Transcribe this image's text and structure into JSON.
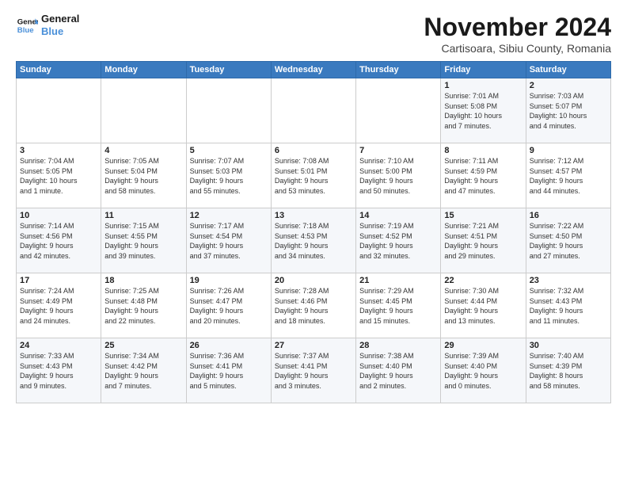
{
  "header": {
    "logo_line1": "General",
    "logo_line2": "Blue",
    "title": "November 2024",
    "subtitle": "Cartisoara, Sibiu County, Romania"
  },
  "weekdays": [
    "Sunday",
    "Monday",
    "Tuesday",
    "Wednesday",
    "Thursday",
    "Friday",
    "Saturday"
  ],
  "weeks": [
    [
      {
        "day": "",
        "info": ""
      },
      {
        "day": "",
        "info": ""
      },
      {
        "day": "",
        "info": ""
      },
      {
        "day": "",
        "info": ""
      },
      {
        "day": "",
        "info": ""
      },
      {
        "day": "1",
        "info": "Sunrise: 7:01 AM\nSunset: 5:08 PM\nDaylight: 10 hours\nand 7 minutes."
      },
      {
        "day": "2",
        "info": "Sunrise: 7:03 AM\nSunset: 5:07 PM\nDaylight: 10 hours\nand 4 minutes."
      }
    ],
    [
      {
        "day": "3",
        "info": "Sunrise: 7:04 AM\nSunset: 5:05 PM\nDaylight: 10 hours\nand 1 minute."
      },
      {
        "day": "4",
        "info": "Sunrise: 7:05 AM\nSunset: 5:04 PM\nDaylight: 9 hours\nand 58 minutes."
      },
      {
        "day": "5",
        "info": "Sunrise: 7:07 AM\nSunset: 5:03 PM\nDaylight: 9 hours\nand 55 minutes."
      },
      {
        "day": "6",
        "info": "Sunrise: 7:08 AM\nSunset: 5:01 PM\nDaylight: 9 hours\nand 53 minutes."
      },
      {
        "day": "7",
        "info": "Sunrise: 7:10 AM\nSunset: 5:00 PM\nDaylight: 9 hours\nand 50 minutes."
      },
      {
        "day": "8",
        "info": "Sunrise: 7:11 AM\nSunset: 4:59 PM\nDaylight: 9 hours\nand 47 minutes."
      },
      {
        "day": "9",
        "info": "Sunrise: 7:12 AM\nSunset: 4:57 PM\nDaylight: 9 hours\nand 44 minutes."
      }
    ],
    [
      {
        "day": "10",
        "info": "Sunrise: 7:14 AM\nSunset: 4:56 PM\nDaylight: 9 hours\nand 42 minutes."
      },
      {
        "day": "11",
        "info": "Sunrise: 7:15 AM\nSunset: 4:55 PM\nDaylight: 9 hours\nand 39 minutes."
      },
      {
        "day": "12",
        "info": "Sunrise: 7:17 AM\nSunset: 4:54 PM\nDaylight: 9 hours\nand 37 minutes."
      },
      {
        "day": "13",
        "info": "Sunrise: 7:18 AM\nSunset: 4:53 PM\nDaylight: 9 hours\nand 34 minutes."
      },
      {
        "day": "14",
        "info": "Sunrise: 7:19 AM\nSunset: 4:52 PM\nDaylight: 9 hours\nand 32 minutes."
      },
      {
        "day": "15",
        "info": "Sunrise: 7:21 AM\nSunset: 4:51 PM\nDaylight: 9 hours\nand 29 minutes."
      },
      {
        "day": "16",
        "info": "Sunrise: 7:22 AM\nSunset: 4:50 PM\nDaylight: 9 hours\nand 27 minutes."
      }
    ],
    [
      {
        "day": "17",
        "info": "Sunrise: 7:24 AM\nSunset: 4:49 PM\nDaylight: 9 hours\nand 24 minutes."
      },
      {
        "day": "18",
        "info": "Sunrise: 7:25 AM\nSunset: 4:48 PM\nDaylight: 9 hours\nand 22 minutes."
      },
      {
        "day": "19",
        "info": "Sunrise: 7:26 AM\nSunset: 4:47 PM\nDaylight: 9 hours\nand 20 minutes."
      },
      {
        "day": "20",
        "info": "Sunrise: 7:28 AM\nSunset: 4:46 PM\nDaylight: 9 hours\nand 18 minutes."
      },
      {
        "day": "21",
        "info": "Sunrise: 7:29 AM\nSunset: 4:45 PM\nDaylight: 9 hours\nand 15 minutes."
      },
      {
        "day": "22",
        "info": "Sunrise: 7:30 AM\nSunset: 4:44 PM\nDaylight: 9 hours\nand 13 minutes."
      },
      {
        "day": "23",
        "info": "Sunrise: 7:32 AM\nSunset: 4:43 PM\nDaylight: 9 hours\nand 11 minutes."
      }
    ],
    [
      {
        "day": "24",
        "info": "Sunrise: 7:33 AM\nSunset: 4:43 PM\nDaylight: 9 hours\nand 9 minutes."
      },
      {
        "day": "25",
        "info": "Sunrise: 7:34 AM\nSunset: 4:42 PM\nDaylight: 9 hours\nand 7 minutes."
      },
      {
        "day": "26",
        "info": "Sunrise: 7:36 AM\nSunset: 4:41 PM\nDaylight: 9 hours\nand 5 minutes."
      },
      {
        "day": "27",
        "info": "Sunrise: 7:37 AM\nSunset: 4:41 PM\nDaylight: 9 hours\nand 3 minutes."
      },
      {
        "day": "28",
        "info": "Sunrise: 7:38 AM\nSunset: 4:40 PM\nDaylight: 9 hours\nand 2 minutes."
      },
      {
        "day": "29",
        "info": "Sunrise: 7:39 AM\nSunset: 4:40 PM\nDaylight: 9 hours\nand 0 minutes."
      },
      {
        "day": "30",
        "info": "Sunrise: 7:40 AM\nSunset: 4:39 PM\nDaylight: 8 hours\nand 58 minutes."
      }
    ]
  ]
}
